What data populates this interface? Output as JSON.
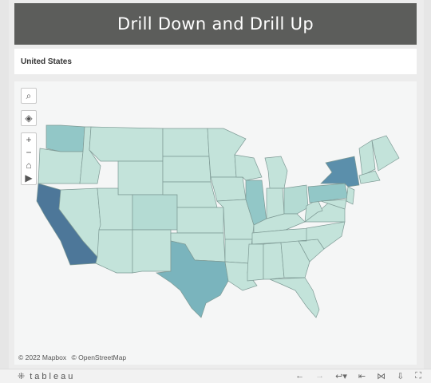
{
  "dashboard": {
    "title": "Drill Down and Drill Up",
    "subtitle": "United States"
  },
  "map": {
    "attribution": [
      "© 2022 Mapbox",
      "© OpenStreetMap"
    ],
    "tools": [
      "search-icon",
      "layers-icon"
    ],
    "zoom_controls": [
      "+",
      "−",
      "⌂",
      "▶"
    ],
    "colors": {
      "base": "#c3e3da",
      "light": "#b4dbd3",
      "medium": "#92c7c7",
      "texas": "#7ab4bd",
      "new_york": "#5b8fab",
      "california": "#4d7799"
    },
    "highlighted_states": [
      "California",
      "New York",
      "Texas",
      "Washington",
      "Pennsylvania",
      "Illinois",
      "Ohio"
    ]
  },
  "footer": {
    "brand": "tableau",
    "controls": [
      "undo-icon",
      "redo-icon",
      "revert-icon",
      "reset-icon",
      "share-icon",
      "download-icon",
      "fullscreen-icon"
    ]
  }
}
